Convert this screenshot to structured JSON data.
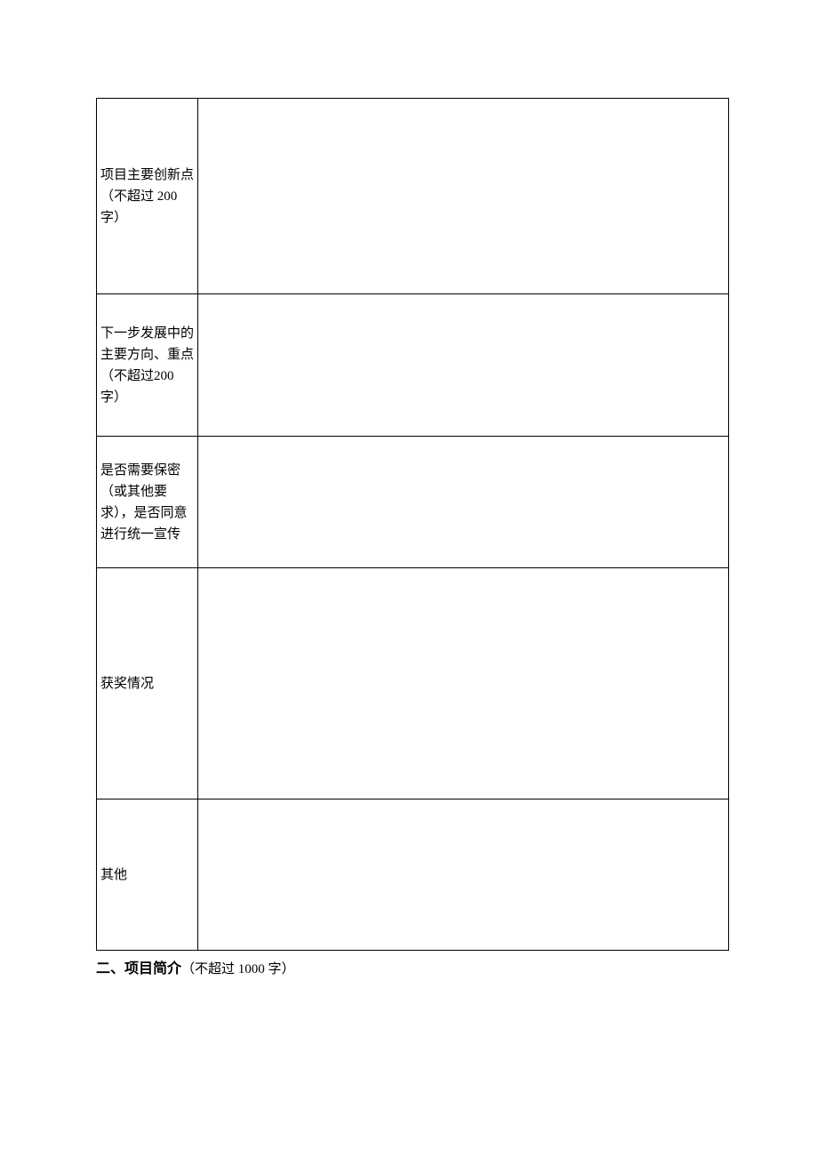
{
  "table": {
    "rows": [
      {
        "label": "项目主要创新点（不超过 200字）",
        "content": ""
      },
      {
        "label": "下一步发展中的主要方向、重点（不超过200 字）",
        "content": ""
      },
      {
        "label": "是否需要保密（或其他要求），是否同意进行统一宣传",
        "content": ""
      },
      {
        "label": "获奖情况",
        "content": ""
      },
      {
        "label": "其他",
        "content": ""
      }
    ]
  },
  "section": {
    "prefix": "二、",
    "title": "项目简介",
    "note": "（不超过 1000 字）"
  }
}
